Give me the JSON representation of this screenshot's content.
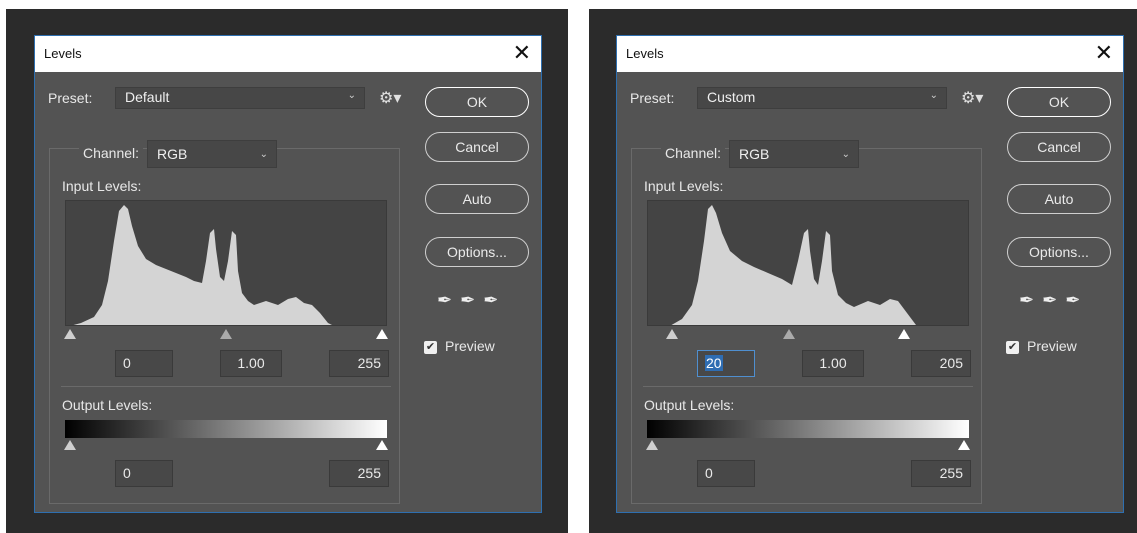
{
  "dialogs": [
    {
      "title": "Levels",
      "close_icon": "close-icon",
      "preset_label": "Preset:",
      "preset_value": "Default",
      "gear_icon": "gear-icon",
      "buttons": {
        "ok": "OK",
        "cancel": "Cancel",
        "auto": "Auto",
        "options": "Options..."
      },
      "channel_label": "Channel:",
      "channel_value": "RGB",
      "input_levels_label": "Input Levels:",
      "input_black": "0",
      "input_gamma": "1.00",
      "input_white": "255",
      "output_levels_label": "Output Levels:",
      "output_black": "0",
      "output_white": "255",
      "preview_label": "Preview",
      "preview_checked": true,
      "eyedropper_icons": [
        "black-eyedropper-icon",
        "gray-eyedropper-icon",
        "white-eyedropper-icon"
      ]
    },
    {
      "title": "Levels",
      "close_icon": "close-icon",
      "preset_label": "Preset:",
      "preset_value": "Custom",
      "gear_icon": "gear-icon",
      "buttons": {
        "ok": "OK",
        "cancel": "Cancel",
        "auto": "Auto",
        "options": "Options..."
      },
      "channel_label": "Channel:",
      "channel_value": "RGB",
      "input_levels_label": "Input Levels:",
      "input_black": "20",
      "input_gamma": "1.00",
      "input_white": "205",
      "output_levels_label": "Output Levels:",
      "output_black": "0",
      "output_white": "255",
      "preview_label": "Preview",
      "preview_checked": true,
      "eyedropper_icons": [
        "black-eyedropper-icon",
        "gray-eyedropper-icon",
        "white-eyedropper-icon"
      ]
    }
  ],
  "colors": {
    "dialog_bg": "#535353",
    "frame_bg": "#2b2b2b",
    "accent": "#2e6fb0",
    "histogram": "#d4d4d4"
  }
}
